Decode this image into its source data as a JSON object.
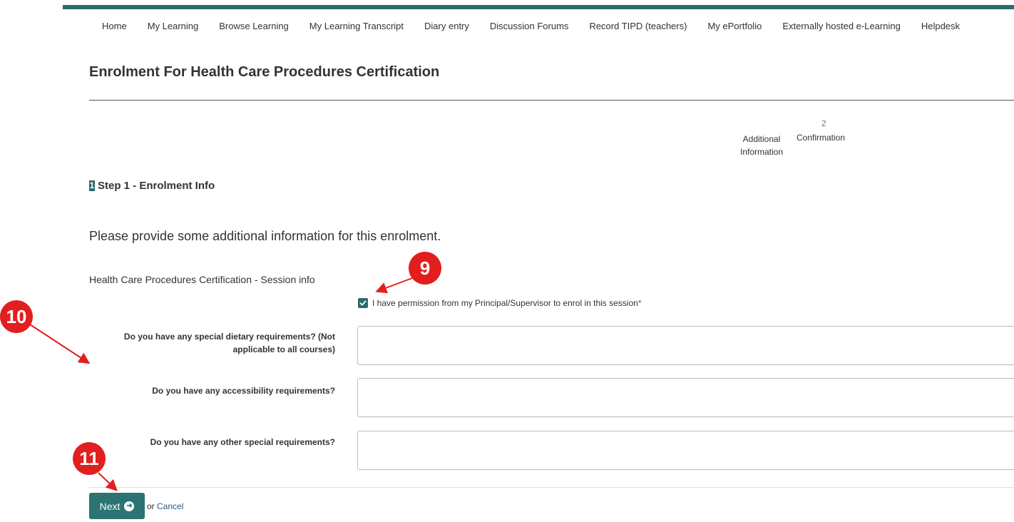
{
  "nav": {
    "items": [
      {
        "label": "Home"
      },
      {
        "label": "My Learning"
      },
      {
        "label": "Browse Learning"
      },
      {
        "label": "My Learning Transcript"
      },
      {
        "label": "Diary entry"
      },
      {
        "label": "Discussion Forums"
      },
      {
        "label": "Record TIPD (teachers)"
      },
      {
        "label": "My ePortfolio"
      },
      {
        "label": "Externally hosted e-Learning"
      },
      {
        "label": "Helpdesk"
      }
    ]
  },
  "page": {
    "title": "Enrolment For Health Care Procedures Certification"
  },
  "wizard": {
    "step2_number": "2",
    "step_additional_line1": "Additional",
    "step_additional_line2": "Information",
    "step_confirmation": "Confirmation",
    "current_badge": "1",
    "current_heading": "Step 1 - Enrolment Info"
  },
  "form": {
    "intro": "Please provide some additional information for this enrolment.",
    "session_info": "Health Care Procedures Certification - Session info",
    "permission_label": "I have permission from my Principal/Supervisor to enrol in this session",
    "permission_checked": true,
    "required_mark": "*",
    "questions": [
      {
        "label": "Do you have any special dietary requirements? (Not applicable to all courses)",
        "value": ""
      },
      {
        "label": "Do you have any accessibility requirements?",
        "value": ""
      },
      {
        "label": "Do you have any other special requirements?",
        "value": ""
      }
    ],
    "next_label": "Next",
    "or_text": "or",
    "cancel_label": "Cancel"
  },
  "callouts": {
    "c9": "9",
    "c10": "10",
    "c11": "11",
    "color": "#e31e1e"
  },
  "colors": {
    "accent": "#2b6b6b"
  }
}
